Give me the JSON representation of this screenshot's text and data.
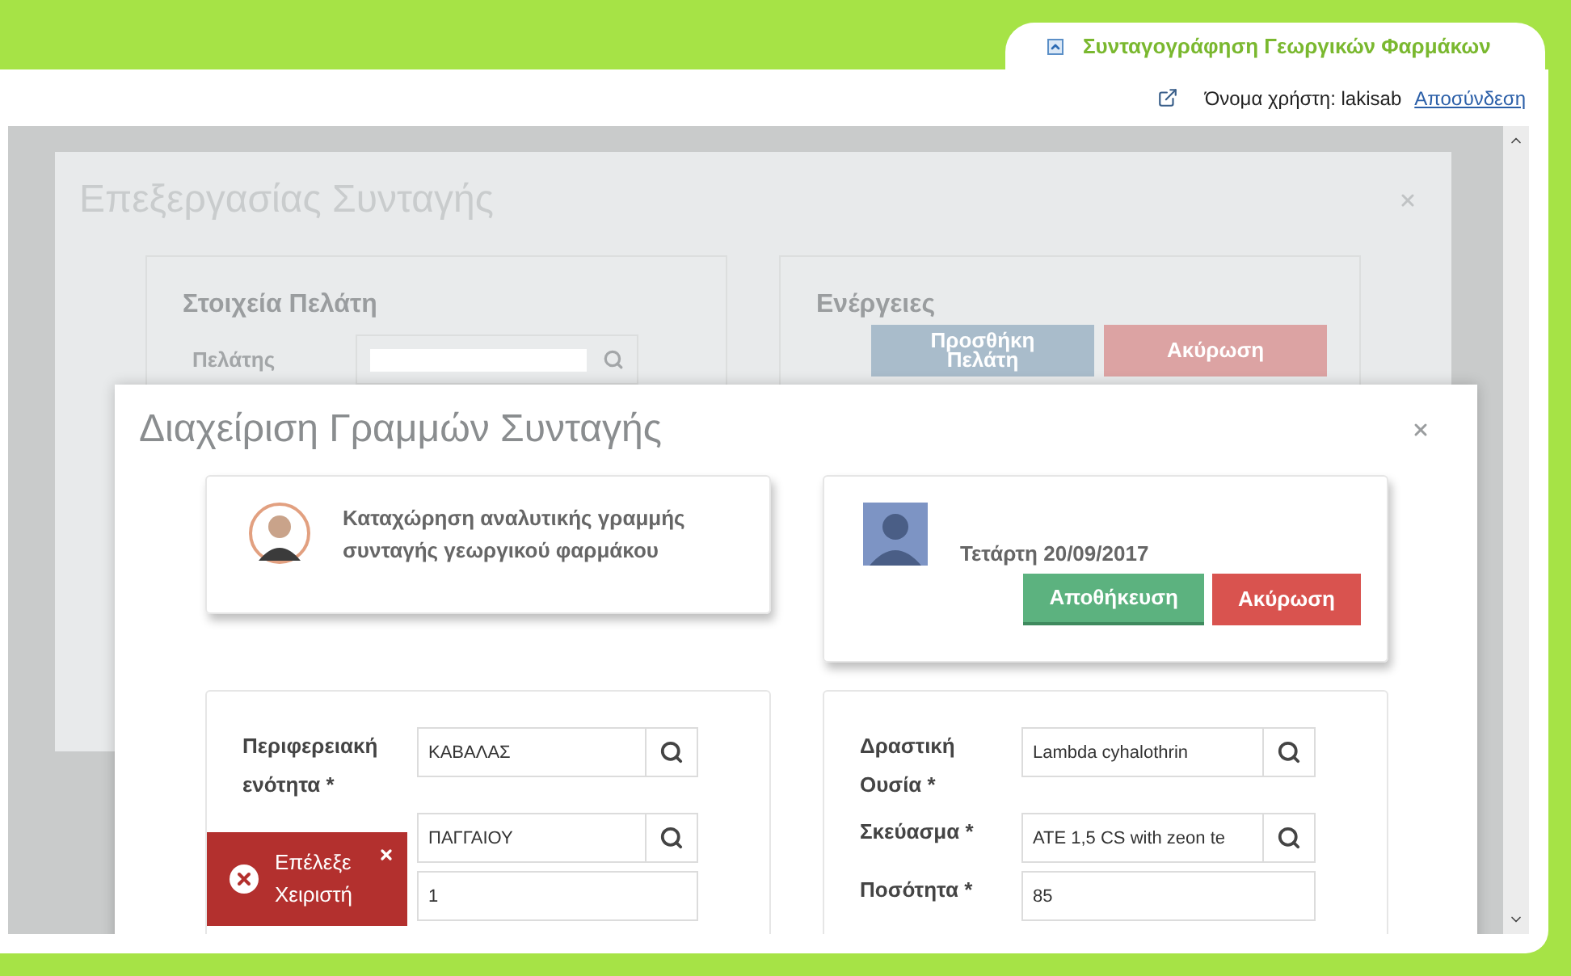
{
  "app_tab": {
    "title": "Συνταγογράφηση Γεωργικών Φαρμάκων"
  },
  "user_bar": {
    "label": "Όνομα χρήστη: lakisab",
    "logout": "Αποσύνδεση"
  },
  "back_dialog": {
    "title": "Επεξεργασίας Συνταγής",
    "customer_card": {
      "title": "Στοιχεία Πελάτη",
      "field_label": "Πελάτης"
    },
    "actions_card": {
      "title": "Ενέργειες",
      "buttons": [
        {
          "label": "Προσθήκη Πελάτη",
          "kind": "primary"
        },
        {
          "label": "Ακύρωση",
          "kind": "danger"
        }
      ]
    }
  },
  "dialog": {
    "title": "Διαχείριση Γραμμών Συνταγής",
    "intro": "Καταχώρηση αναλυτικής γραμμής συνταγής γεωργικού φαρμάκου",
    "date": "Τετάρτη 20/09/2017",
    "buttons": [
      {
        "label": "Αποθήκευση",
        "kind": "success"
      },
      {
        "label": "Ακύρωση",
        "kind": "danger"
      }
    ],
    "left_fields": [
      {
        "label": "Περιφερειακή ενότητα *",
        "value": "ΚΑΒΑΛΑΣ",
        "kind": "lookup"
      },
      {
        "value": "ΠΑΓΓΑΙΟΥ",
        "kind": "lookup"
      },
      {
        "value": "1",
        "kind": "text"
      }
    ],
    "right_fields": [
      {
        "label": "Δραστική Ουσία *",
        "value": "Lambda cyhalothrin",
        "kind": "lookup"
      },
      {
        "label": "Σκεύασμα *",
        "value": "ATE 1,5 CS with zeon te",
        "kind": "lookup"
      },
      {
        "label": "Ποσότητα *",
        "value": "85",
        "kind": "text"
      }
    ]
  },
  "toast": {
    "message": "Επέλεξε Χειριστή"
  }
}
